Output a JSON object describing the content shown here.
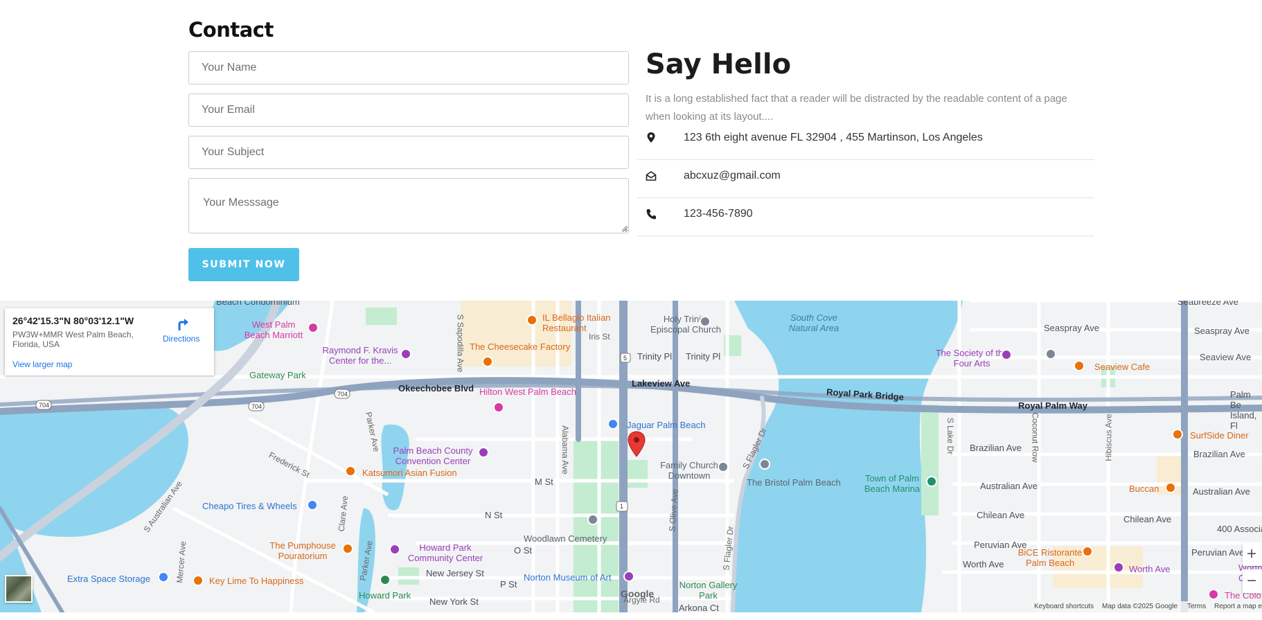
{
  "contact": {
    "title": "Contact",
    "name_placeholder": "Your Name",
    "email_placeholder": "Your Email",
    "subject_placeholder": "Your Subject",
    "message_placeholder": "Your Messsage",
    "submit_label": "SUBMIT NOW"
  },
  "hello": {
    "title": "Say Hello",
    "description": "It is a long established fact that a reader will be distracted by the readable content of a page when looking at its layout....",
    "address": "123 6th eight avenue FL 32904 , 455 Martinson, Los Angeles",
    "email": "abcxuz@gmail.com",
    "phone": "123-456-7890"
  },
  "colors": {
    "accent": "#4fc1e9",
    "map_water": "#8fd4ee",
    "map_major_road": "#8ea3bf",
    "pin_red": "#e53935"
  },
  "map": {
    "card": {
      "coords": "26°42'15.3\"N 80°03'12.1\"W",
      "address": "PW3W+MMR West Palm Beach, Florida, USA",
      "view_larger": "View larger map",
      "directions": "Directions"
    },
    "labels": {
      "beach_condominium": "Beach Condominium",
      "west_palm_marriott": "West Palm Beach Marriott",
      "raymond_kravis": "Raymond F. Kravis Center for the...",
      "gateway_park": "Gateway Park",
      "okeechobee_blvd": "Okeechobee Blvd",
      "okeechobee_blvd_2": "Okeechobee Blvd",
      "hilton": "Hilton West Palm Beach",
      "il_bellagio": "IL Bellagio Italian Restaurant",
      "cheesecake": "The Cheesecake Factory",
      "holy_trinity": "Holy Trinity Episcopal Church",
      "iris_st": "Iris St",
      "trinity_pl": "Trinity Pl",
      "trinity_pl_2": "Trinity Pl",
      "lakeview_ave": "Lakeview Ave",
      "south_cove": "South Cove Natural Area",
      "royal_park_bridge": "Royal Park Bridge",
      "royal_palm_way": "Royal Palm Way",
      "society_four_arts": "The Society of the Four Arts",
      "seaview_cafe": "Seaview Cafe",
      "seabreeze_ave": "Seabreeze Ave",
      "seaspray_ave": "Seaspray Ave",
      "seaspray_ave_2": "Seaspray Ave",
      "seaview_ave": "Seaview Ave",
      "palm_beach_island": "Palm Be Island, Fl",
      "jaguar": "Jaguar Palm Beach",
      "palm_beach_convention": "Palm Beach County Convention Center",
      "katsumori": "Katsumori Asian Fusion",
      "frederick_st": "Frederick St",
      "parker_ave": "Parker Ave",
      "parker_ave_2": "Parker Ave",
      "s_sapodilla": "S Sapodilla Ave",
      "alabama_ave": "Alabama Ave",
      "m_st": "M St",
      "n_st": "N St",
      "o_st": "O St",
      "p_st": "P St",
      "new_jersey_st": "New Jersey St",
      "new_york_st": "New York St",
      "family_church": "Family Church Downtown",
      "bristol": "The Bristol Palm Beach",
      "s_flagler_dr": "S Flagler Dr",
      "s_flagler_dr_2": "S Flagler Dr",
      "s_olive_ave": "S Olive Ave",
      "town_marina": "Town of Palm Beach Marina",
      "brazilian_ave": "Brazilian Ave",
      "brazilian_ave_2": "Brazilian Ave",
      "australian_ave": "Australian Ave",
      "australian_ave_2": "Australian Ave",
      "chilean_ave": "Chilean Ave",
      "chilean_ave_2": "Chilean Ave",
      "peruvian_ave": "Peruvian Ave",
      "peruvian_ave_2": "Peruvian Ave",
      "worth_ave": "Worth Ave",
      "worth_ave_poi": "Worth Ave",
      "s_lake_dr": "S Lake Dr",
      "coconut_row": "Coconut Row",
      "hibiscus_ave": "Hibiscus Ave",
      "surfside": "SurfSide Diner",
      "buccan": "Buccan",
      "assoc_400": "400 Association",
      "bice": "BiCE Ristorante Palm Beach",
      "worth_clock": "Worth Clock",
      "the_colony": "The Colo",
      "cheapo": "Cheapo Tires & Wheels",
      "s_australian_ave": "S Australian Ave",
      "mercer_ave": "Mercer Ave",
      "clare_ave": "Clare Ave",
      "pumphouse": "The Pumphouse Pouratorium",
      "howard_park_cc": "Howard Park Community Center",
      "woodlawn": "Woodlawn Cemetery",
      "norton_museum": "Norton Museum of Art",
      "norton_gallery": "Norton Gallery Park",
      "extra_space": "Extra Space Storage",
      "key_lime": "Key Lime To Happiness",
      "howard_park": "Howard Park",
      "argyle_rd": "Argyle Rd",
      "arkona_ct": "Arkona Ct",
      "shield_704": "704",
      "shield_704_2": "704",
      "shield_704_3": "704",
      "shield_5": "5",
      "shield_1": "1",
      "google": "Google"
    },
    "footer": {
      "shortcuts": "Keyboard shortcuts",
      "map_data": "Map data ©2025 Google",
      "terms": "Terms",
      "report": "Report a map e"
    },
    "zoom_in": "+",
    "zoom_out": "−"
  }
}
